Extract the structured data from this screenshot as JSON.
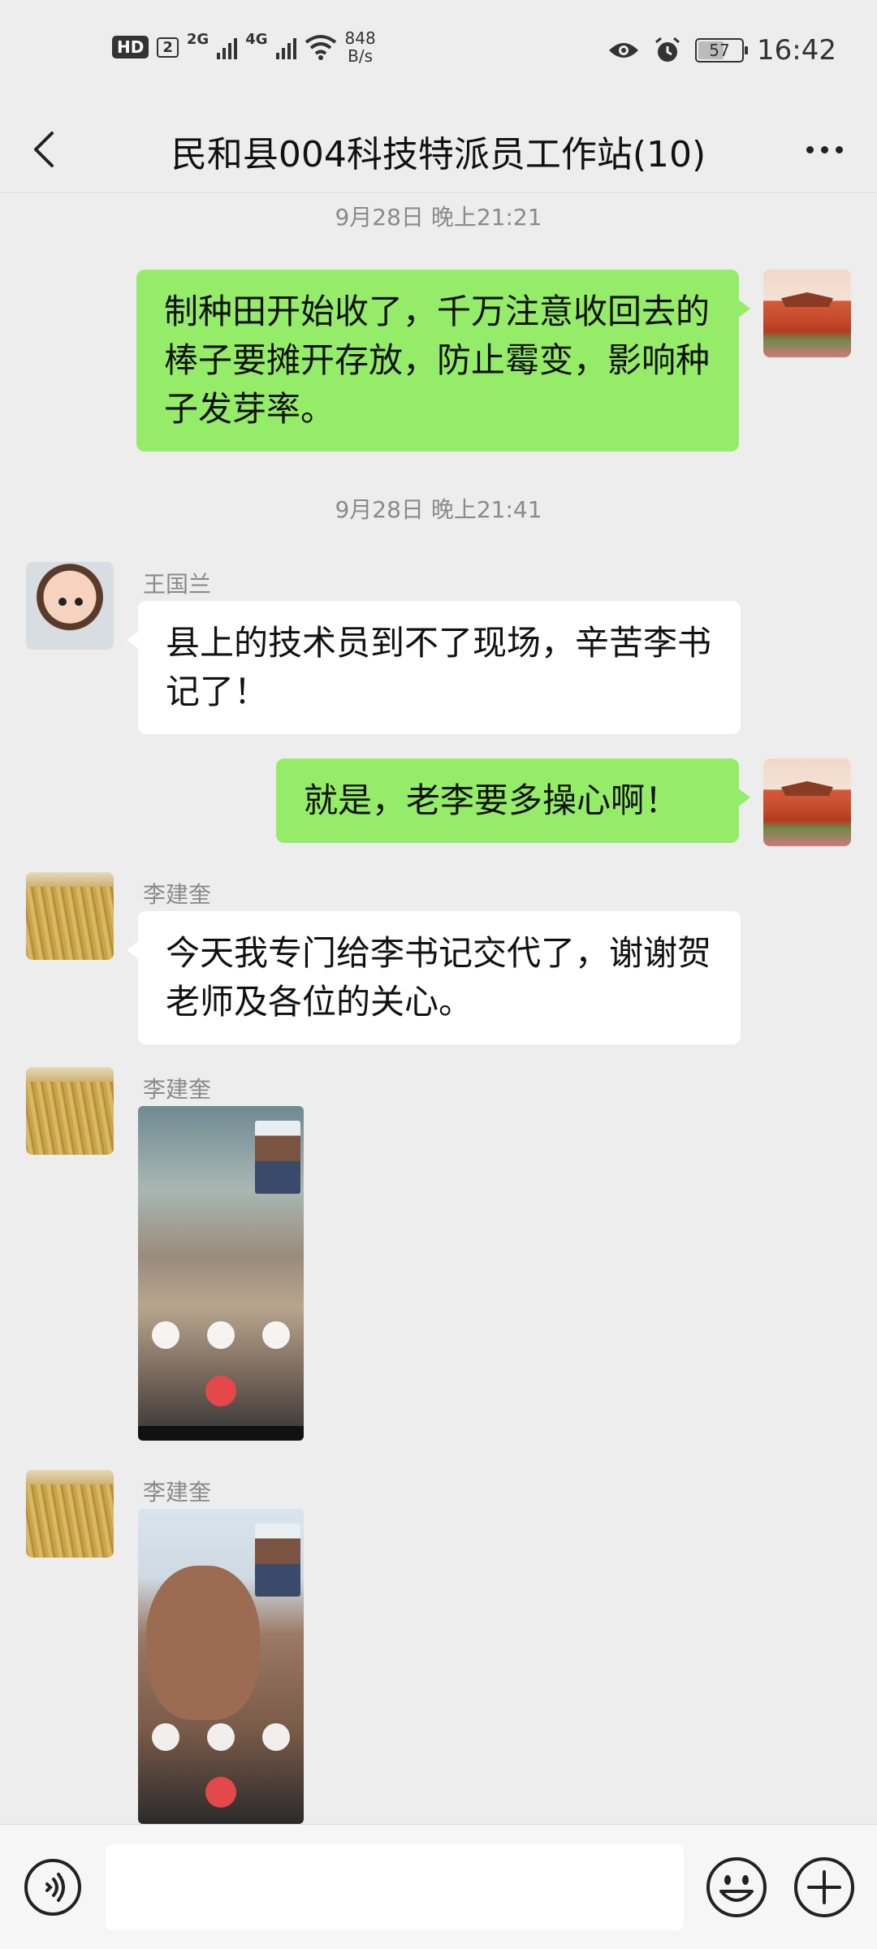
{
  "status_bar": {
    "hd": "HD",
    "sim": "2",
    "net1": "2G",
    "net2": "4G",
    "speed_value": "848",
    "speed_unit": "B/s",
    "battery": "57",
    "time": "16:42"
  },
  "header": {
    "title": "民和县004科技特派员工作站(10)"
  },
  "messages": [
    {
      "type": "time",
      "text": "9月28日 晚上21:21"
    },
    {
      "type": "text",
      "side": "me",
      "text": "制种田开始收了，千万注意收回去的棒子要摊开存放，防止霉变，影响种子发芽率。"
    },
    {
      "type": "time",
      "text": "9月28日 晚上21:41"
    },
    {
      "type": "text",
      "side": "other",
      "sender": "王国兰",
      "text": "县上的技术员到不了现场，辛苦李书记了！"
    },
    {
      "type": "text",
      "side": "me",
      "text": "就是，老李要多操心啊！"
    },
    {
      "type": "text",
      "side": "other",
      "sender": "李建奎",
      "text": "今天我专门给李书记交代了，谢谢贺老师及各位的关心。"
    },
    {
      "type": "image",
      "side": "other",
      "sender": "李建奎"
    },
    {
      "type": "image",
      "side": "other",
      "sender": "李建奎"
    }
  ],
  "colors": {
    "background": "#ededed",
    "my_bubble": "#95ec69",
    "other_bubble": "#ffffff"
  },
  "icons": {
    "back": "chevron-left-icon",
    "more": "more-dots-icon",
    "voice": "voice-input-icon",
    "emoji": "emoji-icon",
    "plus": "plus-icon"
  }
}
